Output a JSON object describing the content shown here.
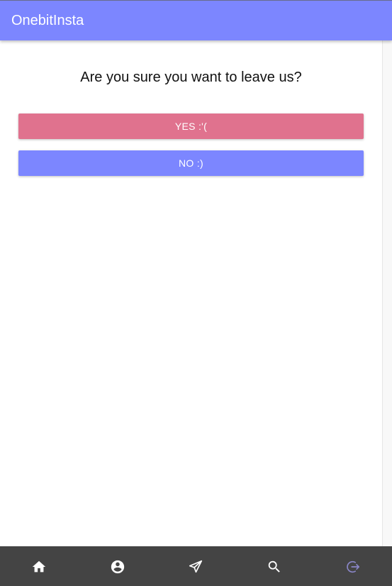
{
  "app": {
    "title": "OnebitInsta"
  },
  "dialog": {
    "question": "Are you sure you want to leave us?",
    "yes_label": "YES :'(",
    "no_label": "NO :)"
  },
  "colors": {
    "appbar": "#7c86ff",
    "yes_button": "#e0728e",
    "no_button": "#7c86ff",
    "bottom_nav": "#444444",
    "active_icon": "#8a86c8"
  },
  "bottom_nav": {
    "items": [
      {
        "icon": "home-icon",
        "active": false
      },
      {
        "icon": "account-circle-icon",
        "active": false
      },
      {
        "icon": "send-icon",
        "active": false
      },
      {
        "icon": "search-icon",
        "active": false
      },
      {
        "icon": "logout-icon",
        "active": true
      }
    ]
  }
}
